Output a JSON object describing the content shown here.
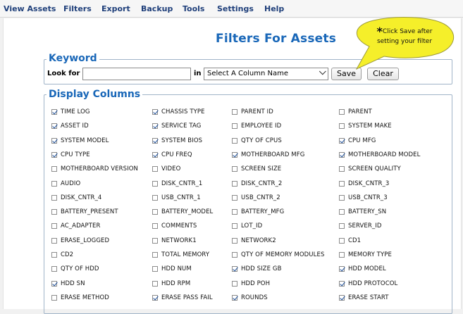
{
  "menu": [
    "View Assets",
    "Filters",
    "Export",
    "Backup",
    "Tools",
    "Settings",
    "Help"
  ],
  "page_title": "Filters For Assets",
  "callout": {
    "star": "*",
    "line1": "Click Save after",
    "line2": "setting your filter"
  },
  "keyword": {
    "legend": "Keyword",
    "look_for_label": "Look for",
    "look_for_value": "",
    "in_label": "in",
    "column_select": "Select A Column Name",
    "save_label": "Save",
    "clear_label": "Clear"
  },
  "display_columns": {
    "legend": "Display Columns",
    "rows": [
      [
        {
          "label": "TIME LOG",
          "checked": true
        },
        {
          "label": "CHASSIS TYPE",
          "checked": true
        },
        {
          "label": "PARENT ID",
          "checked": false
        },
        {
          "label": "PARENT",
          "checked": false
        }
      ],
      [
        {
          "label": "ASSET ID",
          "checked": true
        },
        {
          "label": "SERVICE TAG",
          "checked": true
        },
        {
          "label": "EMPLOYEE ID",
          "checked": false
        },
        {
          "label": "SYSTEM MAKE",
          "checked": false
        }
      ],
      [
        {
          "label": "SYSTEM MODEL",
          "checked": true
        },
        {
          "label": "SYSTEM BIOS",
          "checked": true
        },
        {
          "label": "QTY OF CPUS",
          "checked": false
        },
        {
          "label": "CPU MFG",
          "checked": true
        }
      ],
      [
        {
          "label": "CPU TYPE",
          "checked": true
        },
        {
          "label": "CPU FREQ",
          "checked": true
        },
        {
          "label": "MOTHERBOARD MFG",
          "checked": true
        },
        {
          "label": "MOTHERBOARD MODEL",
          "checked": true
        }
      ],
      [
        {
          "label": "MOTHERBOARD VERSION",
          "checked": false
        },
        {
          "label": "VIDEO",
          "checked": false
        },
        {
          "label": "SCREEN SIZE",
          "checked": false
        },
        {
          "label": "SCREEN QUALITY",
          "checked": false
        }
      ],
      [
        {
          "label": "AUDIO",
          "checked": false
        },
        {
          "label": "DISK_CNTR_1",
          "checked": false
        },
        {
          "label": "DISK_CNTR_2",
          "checked": false
        },
        {
          "label": "DISK_CNTR_3",
          "checked": false
        }
      ],
      [
        {
          "label": "DISK_CNTR_4",
          "checked": false
        },
        {
          "label": "USB_CNTR_1",
          "checked": false
        },
        {
          "label": "USB_CNTR_2",
          "checked": false
        },
        {
          "label": "USB_CNTR_3",
          "checked": false
        }
      ],
      [
        {
          "label": "BATTERY_PRESENT",
          "checked": false
        },
        {
          "label": "BATTERY_MODEL",
          "checked": false
        },
        {
          "label": "BATTERY_MFG",
          "checked": false
        },
        {
          "label": "BATTERY_SN",
          "checked": false
        }
      ],
      [
        {
          "label": "AC_ADAPTER",
          "checked": false
        },
        {
          "label": "COMMENTS",
          "checked": false
        },
        {
          "label": "LOT_ID",
          "checked": false
        },
        {
          "label": "SERVER_ID",
          "checked": false
        }
      ],
      [
        {
          "label": "ERASE_LOGGED",
          "checked": false
        },
        {
          "label": "NETWORK1",
          "checked": false
        },
        {
          "label": "NETWORK2",
          "checked": false
        },
        {
          "label": "CD1",
          "checked": false
        }
      ],
      [
        {
          "label": "CD2",
          "checked": false
        },
        {
          "label": "TOTAL MEMORY",
          "checked": false
        },
        {
          "label": "QTY OF MEMORY MODULES",
          "checked": false
        },
        {
          "label": "MEMORY TYPE",
          "checked": false
        }
      ],
      [
        {
          "label": "QTY OF HDD",
          "checked": false
        },
        {
          "label": "HDD NUM",
          "checked": false
        },
        {
          "label": "HDD SIZE GB",
          "checked": true
        },
        {
          "label": "HDD MODEL",
          "checked": true
        }
      ],
      [
        {
          "label": "HDD SN",
          "checked": true
        },
        {
          "label": "HDD RPM",
          "checked": false
        },
        {
          "label": "HDD POH",
          "checked": false
        },
        {
          "label": "HDD PROTOCOL",
          "checked": true
        }
      ],
      [
        {
          "label": "ERASE METHOD",
          "checked": false
        },
        {
          "label": "ERASE PASS FAIL",
          "checked": true
        },
        {
          "label": "ROUNDS",
          "checked": true
        },
        {
          "label": "ERASE START",
          "checked": true
        }
      ]
    ]
  },
  "colors": {
    "accent_blue": "#1967b8",
    "menu_text": "#1f3f7a",
    "callout_fill": "#f5ef2a"
  }
}
